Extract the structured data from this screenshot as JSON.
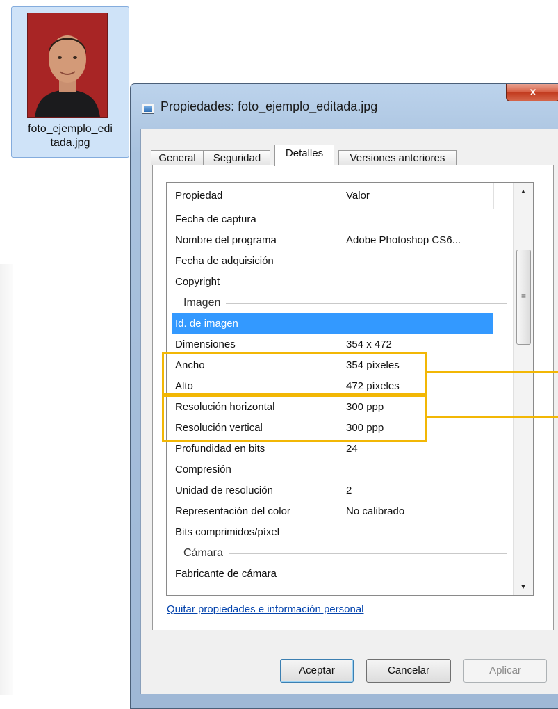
{
  "desktop": {
    "file_name_line1": "foto_ejemplo_edi",
    "file_name_line2": "tada.jpg"
  },
  "dialog": {
    "title": "Propiedades: foto_ejemplo_editada.jpg",
    "close_label": "x",
    "tabs": [
      {
        "label": "General"
      },
      {
        "label": "Seguridad"
      },
      {
        "label": "Detalles"
      },
      {
        "label": "Versiones anteriores"
      }
    ],
    "active_tab": "Detalles",
    "columns": {
      "property": "Propiedad",
      "value": "Valor"
    },
    "rows": [
      {
        "property": "Fecha de captura",
        "value": ""
      },
      {
        "property": "Nombre del programa",
        "value": "Adobe Photoshop CS6..."
      },
      {
        "property": "Fecha de adquisición",
        "value": ""
      },
      {
        "property": "Copyright",
        "value": ""
      },
      {
        "group": "Imagen"
      },
      {
        "property": "Id. de imagen",
        "value": "",
        "selected": true
      },
      {
        "property": "Dimensiones",
        "value": "354 x 472"
      },
      {
        "property": "Ancho",
        "value": "354 píxeles"
      },
      {
        "property": "Alto",
        "value": "472 píxeles"
      },
      {
        "property": "Resolución horizontal",
        "value": "300 ppp"
      },
      {
        "property": "Resolución vertical",
        "value": "300 ppp"
      },
      {
        "property": "Profundidad en bits",
        "value": "24"
      },
      {
        "property": "Compresión",
        "value": ""
      },
      {
        "property": "Unidad de resolución",
        "value": "2"
      },
      {
        "property": "Representación del color",
        "value": "No calibrado"
      },
      {
        "property": "Bits comprimidos/píxel",
        "value": ""
      },
      {
        "group": "Cámara"
      },
      {
        "property": "Fabricante de cámara",
        "value": ""
      }
    ],
    "scroll_grip": "≡",
    "remove_link": "Quitar propiedades e información personal",
    "buttons": {
      "ok": "Aceptar",
      "cancel": "Cancelar",
      "apply": "Aplicar"
    }
  },
  "colors": {
    "selection": "#3399ff",
    "highlight": "#f2b705",
    "close_button": "#c94a2f"
  }
}
